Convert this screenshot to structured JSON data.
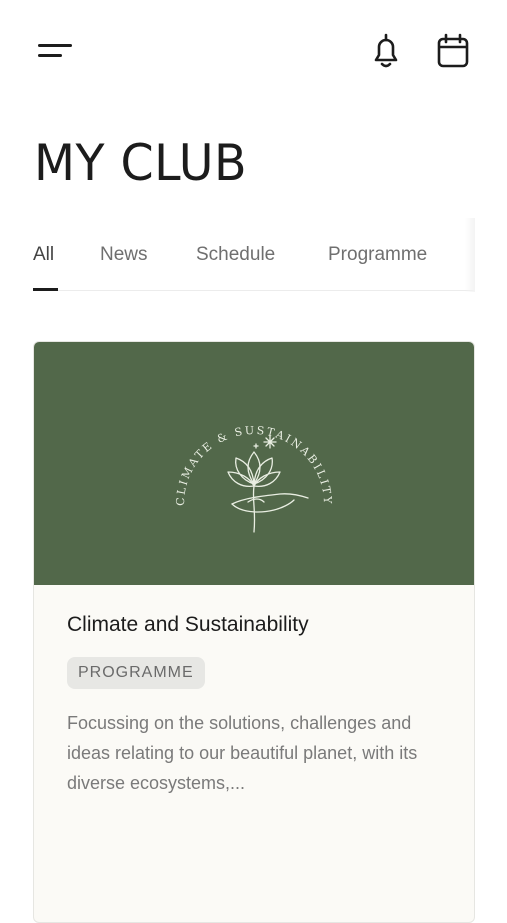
{
  "header": {
    "menu_icon": "hamburger-menu-icon",
    "notifications_icon": "bell-icon",
    "calendar_icon": "calendar-icon"
  },
  "page_title": "MY CLUB",
  "tabs": [
    {
      "label": "All",
      "active": true
    },
    {
      "label": "News",
      "active": false
    },
    {
      "label": "Schedule",
      "active": false
    },
    {
      "label": "Programme",
      "active": false
    }
  ],
  "card": {
    "image_text": "CLIMATE & SUSTAINABILITY",
    "image_background": "#52684a",
    "title": "Climate and Sustainability",
    "badge": "PROGRAMME",
    "description": "Focussing on the solutions, challenges and ideas relating to our beautiful planet, with its diverse ecosystems,..."
  }
}
